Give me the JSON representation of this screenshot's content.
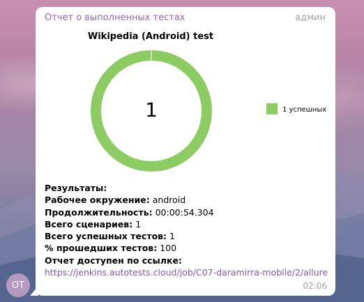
{
  "message": {
    "sender": "Отчет о выполненных тестах",
    "role": "админ",
    "time": "02:06",
    "avatar_initials": "ОТ"
  },
  "chart_data": {
    "type": "pie",
    "title": "Wikipedia (Android) test",
    "center_label": "1",
    "categories": [
      "1 успешных"
    ],
    "values": [
      1
    ],
    "colors": [
      "#8dcc63"
    ],
    "legend_position": "right"
  },
  "results": {
    "heading": "Результаты:",
    "env_label": "Рабочее окружение:",
    "env_value": "android",
    "duration_label": "Продолжительность:",
    "duration_value": "00:00:54.304",
    "scenarios_label": "Всего сценариев:",
    "scenarios_value": "1",
    "passed_label": "Всего успешных тестов:",
    "passed_value": "1",
    "percent_label": "% прошедших тестов:",
    "percent_value": "100",
    "link_label": "Отчет доступен по ссылке:",
    "link_url": "https://jenkins.autotests.cloud/job/C07-daramirra-mobile/2/allure"
  }
}
